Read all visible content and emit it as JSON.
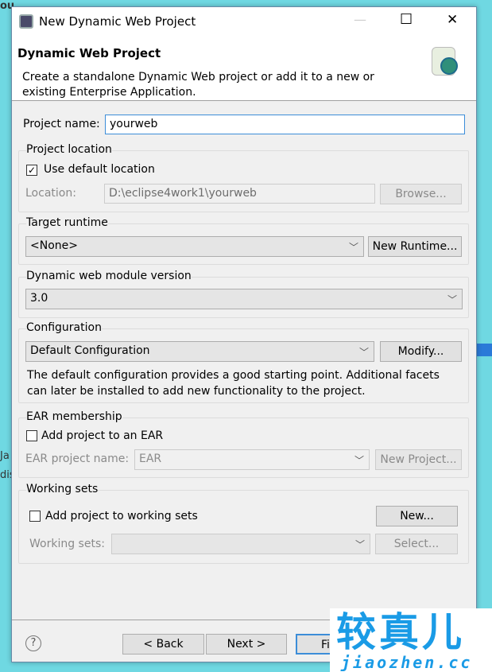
{
  "background": {
    "lines": [
      "ou",
      "Ja",
      "dis"
    ]
  },
  "window": {
    "title": "New Dynamic Web Project",
    "minimize": "—",
    "maximize": "☐",
    "close": "✕"
  },
  "header": {
    "title": "Dynamic Web Project",
    "description_1": "Create a standalone Dynamic Web project or add it to a new or",
    "description_2": "existing Enterprise Application."
  },
  "project_name": {
    "label": "Project name:",
    "value": "yourweb"
  },
  "location": {
    "group": "Project location",
    "use_default_label": "Use default location",
    "use_default_checked": true,
    "location_label": "Location:",
    "location_value": "D:\\eclipse4work1\\yourweb",
    "browse": "Browse..."
  },
  "runtime": {
    "group": "Target runtime",
    "selected": "<None>",
    "new_runtime": "New Runtime..."
  },
  "module_version": {
    "group": "Dynamic web module version",
    "selected": "3.0"
  },
  "configuration": {
    "group": "Configuration",
    "selected": "Default Configuration",
    "modify": "Modify...",
    "desc_1": "The default configuration provides a good starting point. Additional facets",
    "desc_2": "can later be installed to add new functionality to the project."
  },
  "ear": {
    "group": "EAR membership",
    "add_label": "Add project to an EAR",
    "add_checked": false,
    "name_label": "EAR project name:",
    "name_value": "EAR",
    "new_project": "New Project..."
  },
  "working_sets": {
    "group": "Working sets",
    "add_label": "Add project to working sets",
    "add_checked": false,
    "new": "New...",
    "sets_label": "Working sets:",
    "sets_value": "",
    "select": "Select..."
  },
  "footer": {
    "help": "?",
    "back": "< Back",
    "next": "Next >",
    "finish": "Fi"
  },
  "watermark": {
    "cn": "较真儿",
    "url": "jiaozhen.cc",
    "color": "#1a9be6"
  }
}
